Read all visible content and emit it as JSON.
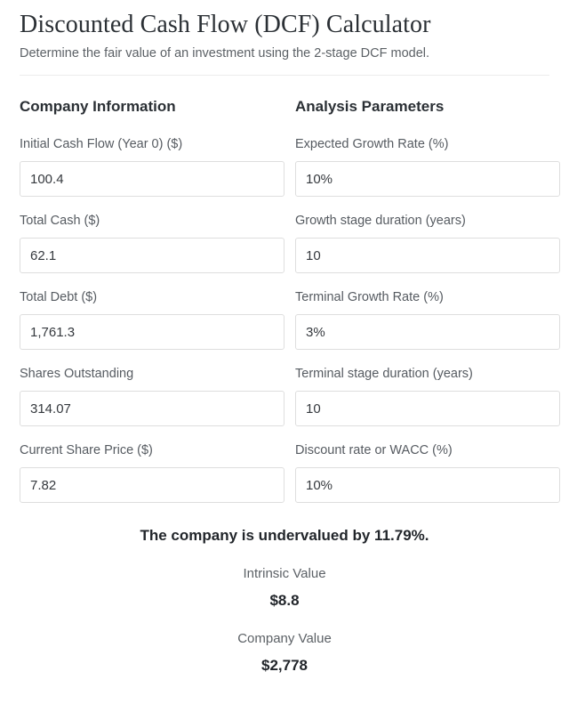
{
  "header": {
    "title": "Discounted Cash Flow (DCF) Calculator",
    "subtitle": "Determine the fair value of an investment using the 2-stage DCF model."
  },
  "columns": [
    {
      "title": "Company Information",
      "fields": [
        {
          "label": "Initial Cash Flow (Year 0) ($)",
          "value": "100.4",
          "placeholder": "Initial Cash Flow (Year 0) ($)"
        },
        {
          "label": "Total Cash ($)",
          "value": "62.1",
          "placeholder": "Total Cash ($)"
        },
        {
          "label": "Total Debt ($)",
          "value": "1,761.3",
          "placeholder": "Total Debt ($)"
        },
        {
          "label": "Shares Outstanding",
          "value": "314.07",
          "placeholder": "Shares Outstanding"
        },
        {
          "label": "Current Share Price ($)",
          "value": "7.82",
          "placeholder": "Current Share Price ($)"
        }
      ]
    },
    {
      "title": "Analysis Parameters",
      "fields": [
        {
          "label": "Expected Growth Rate (%)",
          "value": "10%",
          "placeholder": "Expected Growth Rate (%)"
        },
        {
          "label": "Growth stage duration (years)",
          "value": "10",
          "placeholder": "Growth stage duration (years)"
        },
        {
          "label": "Terminal Growth Rate (%)",
          "value": "3%",
          "placeholder": "Terminal Growth Rate (%)"
        },
        {
          "label": "Terminal stage duration (years)",
          "value": "10",
          "placeholder": "Terminal stage duration (years)"
        },
        {
          "label": "Discount rate or WACC (%)",
          "value": "10%",
          "placeholder": "Discount rate or WACC (%)"
        }
      ]
    }
  ],
  "results": {
    "verdict": "The company is undervalued by 11.79%.",
    "items": [
      {
        "label": "Intrinsic Value",
        "value": "$8.8"
      },
      {
        "label": "Company Value",
        "value": "$2,778"
      }
    ]
  },
  "colors": {
    "text_primary": "#2b3035",
    "text_secondary": "#565b61",
    "border": "#dedede",
    "divider": "#ececec",
    "background": "#ffffff"
  }
}
